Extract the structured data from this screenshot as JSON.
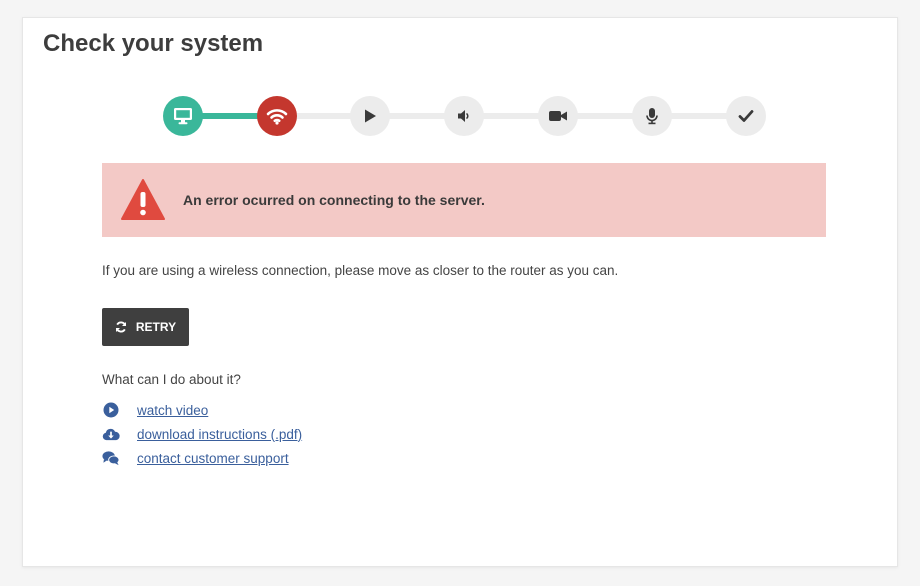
{
  "page": {
    "title": "Check your system"
  },
  "stepper": {
    "steps": [
      {
        "icon": "monitor-icon",
        "status": "done"
      },
      {
        "icon": "wifi-icon",
        "status": "error"
      },
      {
        "icon": "play-icon",
        "status": "pending"
      },
      {
        "icon": "speaker-icon",
        "status": "pending"
      },
      {
        "icon": "video-camera-icon",
        "status": "pending"
      },
      {
        "icon": "microphone-icon",
        "status": "pending"
      },
      {
        "icon": "checkmark-icon",
        "status": "pending"
      }
    ]
  },
  "alert": {
    "icon": "warning-triangle-icon",
    "message": "An error ocurred on connecting to the server."
  },
  "hint": "If you are using a wireless connection, please move as closer to the router as you can.",
  "retry_button": {
    "icon": "refresh-icon",
    "label": "RETRY"
  },
  "help": {
    "heading": "What can I do about it?",
    "links": [
      {
        "icon": "play-circle-icon",
        "label": "watch video"
      },
      {
        "icon": "cloud-download-icon",
        "label": "download instructions (.pdf)"
      },
      {
        "icon": "chat-bubbles-icon",
        "label": "contact customer support"
      }
    ]
  },
  "colors": {
    "success": "#3ab79a",
    "error": "#c4372e",
    "alert_bg": "#f3c9c6",
    "warning_icon": "#e04a3f",
    "link": "#3a5f9c",
    "button_bg": "#3f3f3f"
  }
}
